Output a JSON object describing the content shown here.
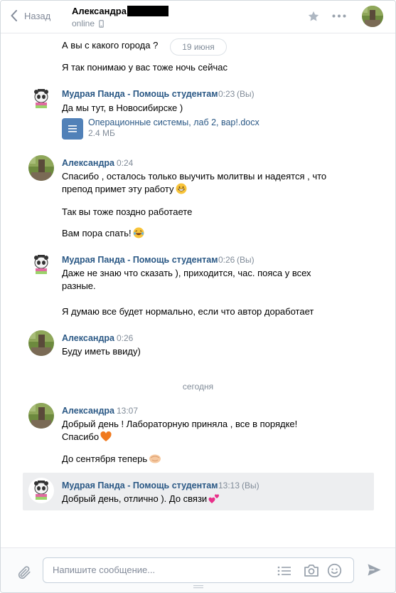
{
  "header": {
    "back_label": "Назад",
    "contact_name": "Александра",
    "status": "online"
  },
  "date_labels": {
    "first": "19 июня",
    "today": "сегодня"
  },
  "messages": [
    {
      "text": "А вы с какого города ?"
    },
    {
      "text": "Я так понимаю у вас тоже ночь сейчас"
    },
    {
      "author": "Мудрая Панда - Помощь студентам",
      "time": "0:23",
      "you": "(Вы)",
      "lines": [
        "Да мы тут, в Новосибирске )"
      ],
      "attachment": {
        "name": "Операционные системы, лаб 2, вар!.docx",
        "size": "2.4 МБ"
      }
    },
    {
      "author": "Александра",
      "time": "0:24",
      "lines": [
        "Спасибо , осталось только выучить молитвы и надеятся , что",
        "препод примет эту работу",
        "Так вы тоже поздно работаете",
        "Вам пора спать!"
      ]
    },
    {
      "author": "Мудрая Панда - Помощь студентам",
      "time": "0:26",
      "you": "(Вы)",
      "lines": [
        "Даже не знаю что сказать ), приходится, час. пояса у всех",
        "разные.",
        "Я думаю все будет нормально, если что автор доработает"
      ]
    },
    {
      "author": "Александра",
      "time": "0:26",
      "lines": [
        "Буду иметь ввиду)"
      ]
    },
    {
      "author": "Александра",
      "time": "13:07",
      "lines": [
        "Добрый день ! Лабораторную приняла , все в порядке!",
        "Спасибо",
        "До сентября теперь"
      ]
    },
    {
      "author": "Мудрая Панда - Помощь студентам",
      "time": "13:13",
      "you": "(Вы)",
      "lines": [
        "Добрый день, отлично ). До связи"
      ]
    }
  ],
  "composer": {
    "placeholder": "Напишите сообщение..."
  }
}
